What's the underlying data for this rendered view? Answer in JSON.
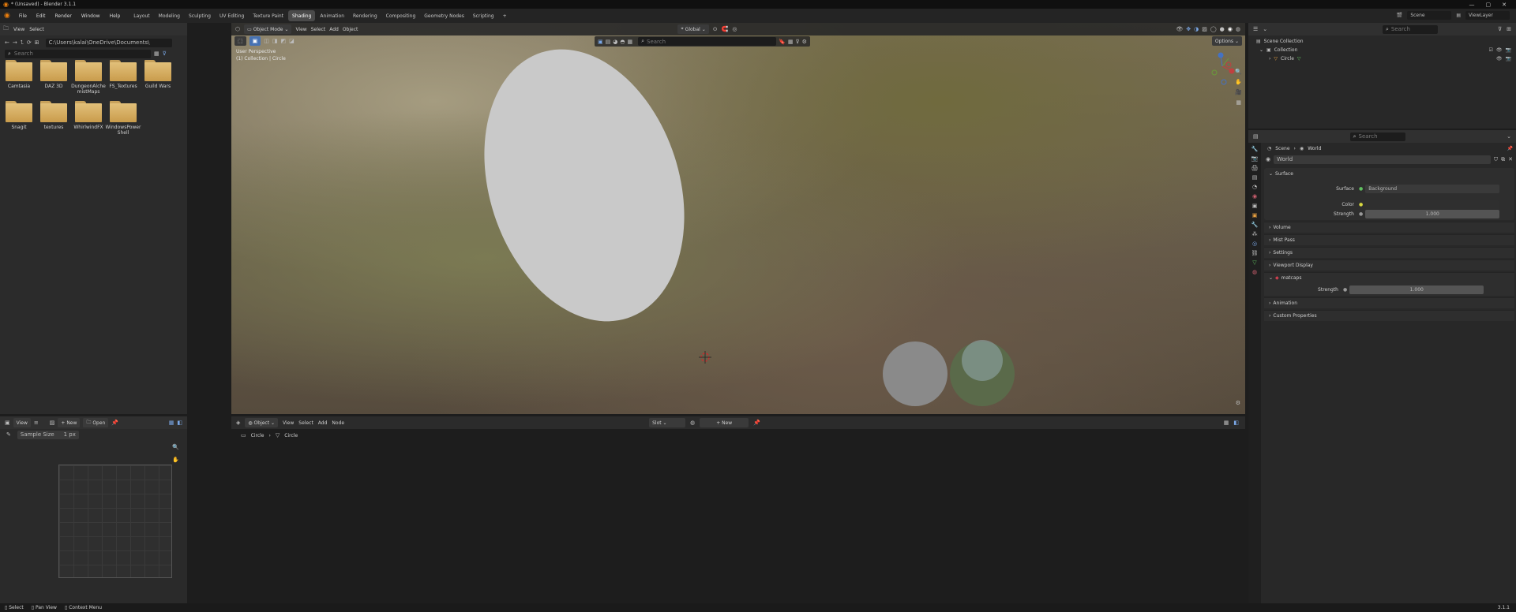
{
  "titlebar": {
    "title": "* (Unsaved) - Blender 3.1.1"
  },
  "menu": {
    "items": [
      "File",
      "Edit",
      "Render",
      "Window",
      "Help"
    ]
  },
  "workspaces": {
    "tabs": [
      "Layout",
      "Modeling",
      "Sculpting",
      "UV Editing",
      "Texture Paint",
      "Shading",
      "Animation",
      "Rendering",
      "Compositing",
      "Geometry Nodes",
      "Scripting"
    ],
    "active": "Shading"
  },
  "scene": {
    "name": "Scene",
    "view_layer": "ViewLayer"
  },
  "file_browser": {
    "menu": [
      "View",
      "Select"
    ],
    "path": "C:\\Users\\kalai\\OneDrive\\Documents\\",
    "search_placeholder": "Search",
    "folders": [
      "Camtasia",
      "DAZ 3D",
      "DungeonAlchemistMaps",
      "FS_Textures",
      "Guild Wars",
      "Snagit",
      "textures",
      "WhirlwindFX",
      "WindowsPowerShell"
    ]
  },
  "image_editor": {
    "view": "View",
    "new": "New",
    "open": "Open",
    "sample_size_label": "Sample Size",
    "sample_size_value": "1 px"
  },
  "viewport": {
    "mode": "Object Mode",
    "menus": [
      "View",
      "Select",
      "Add",
      "Object"
    ],
    "transform": "Global",
    "overlay_line1": "User Perspective",
    "overlay_line2": "(1) Collection | Circle",
    "search_placeholder": "Search",
    "options": "Options"
  },
  "node_editor": {
    "type": "Object",
    "menus": [
      "View",
      "Select",
      "Add",
      "Node"
    ],
    "slot": "Slot",
    "new": "New",
    "breadcrumb": [
      "Circle",
      "Circle"
    ]
  },
  "outliner": {
    "search_placeholder": "Search",
    "root": "Scene Collection",
    "collection": "Collection",
    "object": "Circle"
  },
  "properties": {
    "search_placeholder": "Search",
    "breadcrumb": [
      "Scene",
      "World"
    ],
    "world_name": "World",
    "surface_header": "Surface",
    "surface_label": "Surface",
    "surface_value": "Background",
    "color_label": "Color",
    "strength_label": "Strength",
    "strength_value": "1.000",
    "sections": [
      "Volume",
      "Mist Pass",
      "Settings",
      "Viewport Display"
    ],
    "addon_panel": "matcaps",
    "addon_strength_label": "Strength",
    "addon_strength_value": "1.000",
    "animation": "Animation",
    "custom_properties": "Custom Properties"
  },
  "statusbar": {
    "select": "Select",
    "pan": "Pan View",
    "context": "Context Menu",
    "version": "3.1.1"
  },
  "colors": {
    "accent": "#4772b3",
    "active_tab": "#4a4a4a",
    "panel": "#2b2b2b",
    "folder": "#d9b56b"
  }
}
